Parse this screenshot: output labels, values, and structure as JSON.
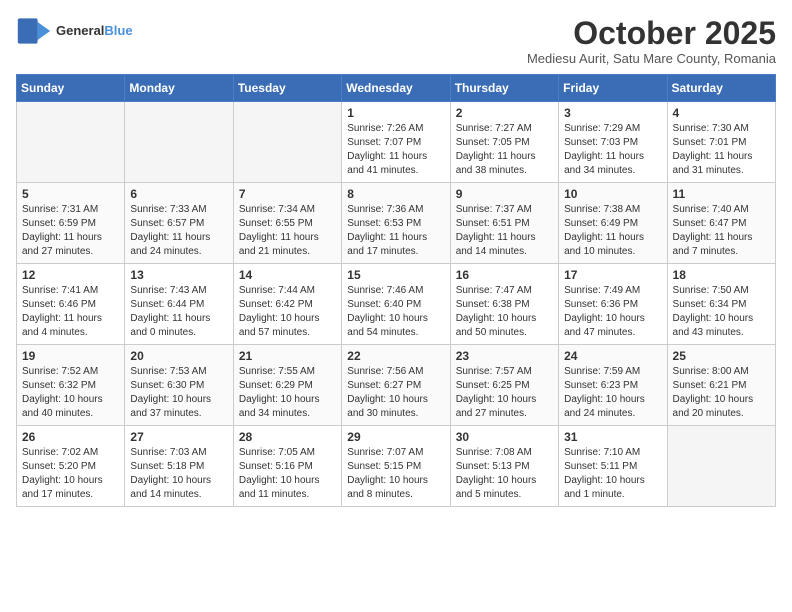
{
  "header": {
    "logo_general": "General",
    "logo_blue": "Blue",
    "month_title": "October 2025",
    "subtitle": "Mediesu Aurit, Satu Mare County, Romania"
  },
  "days_of_week": [
    "Sunday",
    "Monday",
    "Tuesday",
    "Wednesday",
    "Thursday",
    "Friday",
    "Saturday"
  ],
  "weeks": [
    [
      {
        "day": "",
        "info": ""
      },
      {
        "day": "",
        "info": ""
      },
      {
        "day": "",
        "info": ""
      },
      {
        "day": "1",
        "info": "Sunrise: 7:26 AM\nSunset: 7:07 PM\nDaylight: 11 hours and 41 minutes."
      },
      {
        "day": "2",
        "info": "Sunrise: 7:27 AM\nSunset: 7:05 PM\nDaylight: 11 hours and 38 minutes."
      },
      {
        "day": "3",
        "info": "Sunrise: 7:29 AM\nSunset: 7:03 PM\nDaylight: 11 hours and 34 minutes."
      },
      {
        "day": "4",
        "info": "Sunrise: 7:30 AM\nSunset: 7:01 PM\nDaylight: 11 hours and 31 minutes."
      }
    ],
    [
      {
        "day": "5",
        "info": "Sunrise: 7:31 AM\nSunset: 6:59 PM\nDaylight: 11 hours and 27 minutes."
      },
      {
        "day": "6",
        "info": "Sunrise: 7:33 AM\nSunset: 6:57 PM\nDaylight: 11 hours and 24 minutes."
      },
      {
        "day": "7",
        "info": "Sunrise: 7:34 AM\nSunset: 6:55 PM\nDaylight: 11 hours and 21 minutes."
      },
      {
        "day": "8",
        "info": "Sunrise: 7:36 AM\nSunset: 6:53 PM\nDaylight: 11 hours and 17 minutes."
      },
      {
        "day": "9",
        "info": "Sunrise: 7:37 AM\nSunset: 6:51 PM\nDaylight: 11 hours and 14 minutes."
      },
      {
        "day": "10",
        "info": "Sunrise: 7:38 AM\nSunset: 6:49 PM\nDaylight: 11 hours and 10 minutes."
      },
      {
        "day": "11",
        "info": "Sunrise: 7:40 AM\nSunset: 6:47 PM\nDaylight: 11 hours and 7 minutes."
      }
    ],
    [
      {
        "day": "12",
        "info": "Sunrise: 7:41 AM\nSunset: 6:46 PM\nDaylight: 11 hours and 4 minutes."
      },
      {
        "day": "13",
        "info": "Sunrise: 7:43 AM\nSunset: 6:44 PM\nDaylight: 11 hours and 0 minutes."
      },
      {
        "day": "14",
        "info": "Sunrise: 7:44 AM\nSunset: 6:42 PM\nDaylight: 10 hours and 57 minutes."
      },
      {
        "day": "15",
        "info": "Sunrise: 7:46 AM\nSunset: 6:40 PM\nDaylight: 10 hours and 54 minutes."
      },
      {
        "day": "16",
        "info": "Sunrise: 7:47 AM\nSunset: 6:38 PM\nDaylight: 10 hours and 50 minutes."
      },
      {
        "day": "17",
        "info": "Sunrise: 7:49 AM\nSunset: 6:36 PM\nDaylight: 10 hours and 47 minutes."
      },
      {
        "day": "18",
        "info": "Sunrise: 7:50 AM\nSunset: 6:34 PM\nDaylight: 10 hours and 43 minutes."
      }
    ],
    [
      {
        "day": "19",
        "info": "Sunrise: 7:52 AM\nSunset: 6:32 PM\nDaylight: 10 hours and 40 minutes."
      },
      {
        "day": "20",
        "info": "Sunrise: 7:53 AM\nSunset: 6:30 PM\nDaylight: 10 hours and 37 minutes."
      },
      {
        "day": "21",
        "info": "Sunrise: 7:55 AM\nSunset: 6:29 PM\nDaylight: 10 hours and 34 minutes."
      },
      {
        "day": "22",
        "info": "Sunrise: 7:56 AM\nSunset: 6:27 PM\nDaylight: 10 hours and 30 minutes."
      },
      {
        "day": "23",
        "info": "Sunrise: 7:57 AM\nSunset: 6:25 PM\nDaylight: 10 hours and 27 minutes."
      },
      {
        "day": "24",
        "info": "Sunrise: 7:59 AM\nSunset: 6:23 PM\nDaylight: 10 hours and 24 minutes."
      },
      {
        "day": "25",
        "info": "Sunrise: 8:00 AM\nSunset: 6:21 PM\nDaylight: 10 hours and 20 minutes."
      }
    ],
    [
      {
        "day": "26",
        "info": "Sunrise: 7:02 AM\nSunset: 5:20 PM\nDaylight: 10 hours and 17 minutes."
      },
      {
        "day": "27",
        "info": "Sunrise: 7:03 AM\nSunset: 5:18 PM\nDaylight: 10 hours and 14 minutes."
      },
      {
        "day": "28",
        "info": "Sunrise: 7:05 AM\nSunset: 5:16 PM\nDaylight: 10 hours and 11 minutes."
      },
      {
        "day": "29",
        "info": "Sunrise: 7:07 AM\nSunset: 5:15 PM\nDaylight: 10 hours and 8 minutes."
      },
      {
        "day": "30",
        "info": "Sunrise: 7:08 AM\nSunset: 5:13 PM\nDaylight: 10 hours and 5 minutes."
      },
      {
        "day": "31",
        "info": "Sunrise: 7:10 AM\nSunset: 5:11 PM\nDaylight: 10 hours and 1 minute."
      },
      {
        "day": "",
        "info": ""
      }
    ]
  ]
}
